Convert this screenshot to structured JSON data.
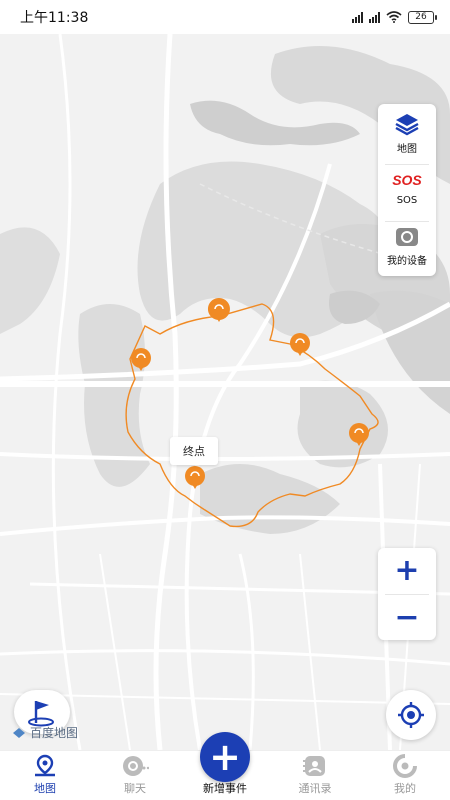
{
  "status_bar": {
    "time": "上午11:38",
    "battery": "26"
  },
  "map": {
    "end_label": "终点",
    "provider_logo_text": "百度地图",
    "route_color": "#f08a24",
    "marker_color": "#f08a24"
  },
  "side_panel": {
    "items": [
      {
        "label": "地图",
        "icon": "layers-icon"
      },
      {
        "label": "SOS",
        "icon": "sos-icon",
        "icon_text": "SOS"
      },
      {
        "label": "我的设备",
        "icon": "device-icon"
      }
    ]
  },
  "zoom": {
    "in_label": "+",
    "out_label": "−"
  },
  "bottom_nav": {
    "items": [
      {
        "label": "地图",
        "icon": "map-pin-icon",
        "active": true
      },
      {
        "label": "聊天",
        "icon": "chat-icon",
        "active": false
      },
      {
        "label": "新增事件",
        "icon": "plus-icon",
        "active": false
      },
      {
        "label": "通讯录",
        "icon": "contacts-icon",
        "active": false
      },
      {
        "label": "我的",
        "icon": "profile-icon",
        "active": false
      }
    ],
    "add_symbol": "+"
  },
  "colors": {
    "accent": "#1c3fb4",
    "inactive": "#999999"
  }
}
